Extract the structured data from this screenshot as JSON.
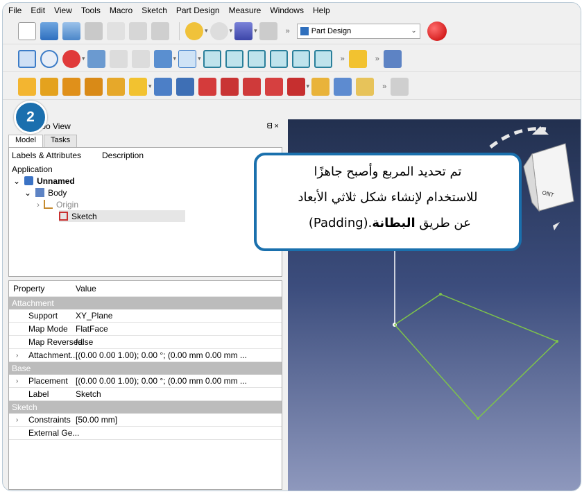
{
  "menu": [
    "File",
    "Edit",
    "View",
    "Tools",
    "Macro",
    "Sketch",
    "Part Design",
    "Measure",
    "Windows",
    "Help"
  ],
  "toolbar": {
    "workbench": "Part Design",
    "more": "»"
  },
  "combo": {
    "title": "Combo View",
    "title_controls": "ᗺ ×",
    "tabs": [
      "Model",
      "Tasks"
    ],
    "tree_headers": [
      "Labels & Attributes",
      "Description"
    ],
    "tree": {
      "root": "Application",
      "doc": "Unnamed",
      "body": "Body",
      "origin": "Origin",
      "sketch": "Sketch"
    }
  },
  "properties": {
    "headers": [
      "Property",
      "Value"
    ],
    "groups": [
      {
        "name": "Attachment",
        "rows": [
          {
            "name": "Support",
            "value": "XY_Plane",
            "expand": false
          },
          {
            "name": "Map Mode",
            "value": "FlatFace",
            "expand": false
          },
          {
            "name": "Map Reversed",
            "value": "false",
            "expand": false
          },
          {
            "name": "Attachment...",
            "value": "[(0.00 0.00 1.00); 0.00 °; (0.00 mm  0.00 mm ...",
            "expand": true
          }
        ]
      },
      {
        "name": "Base",
        "rows": [
          {
            "name": "Placement",
            "value": "[(0.00 0.00 1.00); 0.00 °; (0.00 mm  0.00 mm ...",
            "expand": true
          },
          {
            "name": "Label",
            "value": "Sketch",
            "expand": false
          }
        ]
      },
      {
        "name": "Sketch",
        "rows": [
          {
            "name": "Constraints",
            "value": "[50.00 mm]",
            "expand": true
          },
          {
            "name": "External Ge...",
            "value": "",
            "expand": false
          }
        ]
      }
    ]
  },
  "callout": {
    "line1": "تم تحديد المربع وأصبح جاهزًا",
    "line2": "للاستخدام لإنشاء شكل ثلاثي الأبعاد",
    "line3_pre": "عن طريق ",
    "line3_bold": "البطانة",
    "line3_post": " (Padding)."
  },
  "badge": "2",
  "navcube_label": "ONT",
  "colors": {
    "accent": "#1a70ad",
    "sketch_line": "#7ec34a"
  }
}
